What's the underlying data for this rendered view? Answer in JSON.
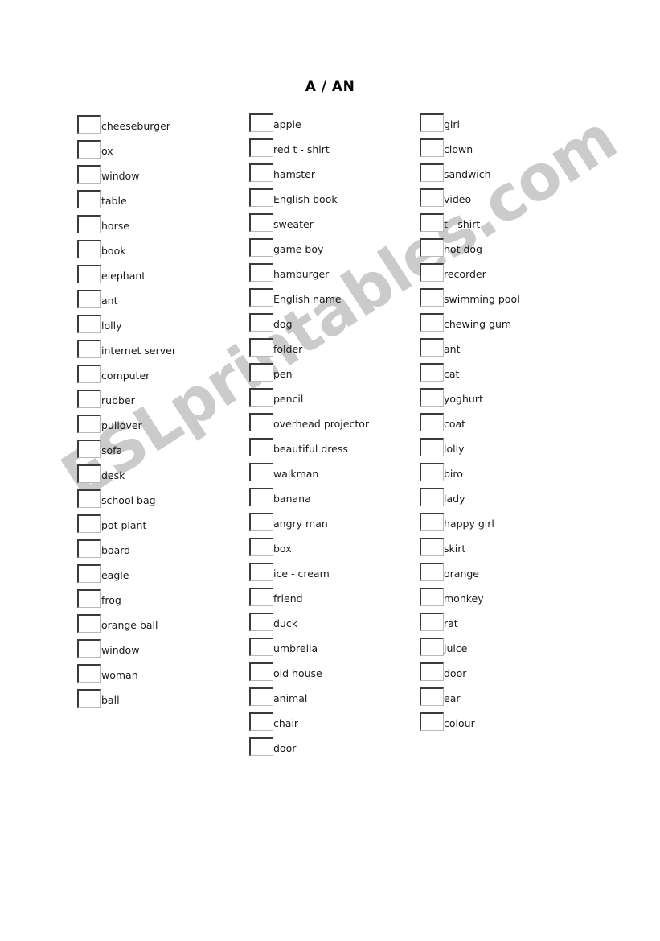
{
  "page": {
    "title": "A / AN",
    "watermark": "ESLprintables.com",
    "watermark_color": "#cbcbcb",
    "background_color": "#ffffff",
    "text_color": "#1a1a1a"
  },
  "columns": [
    {
      "id": "column-1",
      "items": [
        "cheeseburger",
        "ox",
        "window",
        "table",
        "horse",
        "book",
        "elephant",
        "ant",
        "lolly",
        "internet server",
        "computer",
        "rubber",
        "pullover",
        "sofa",
        "desk",
        "school bag",
        "pot plant",
        "board",
        "eagle",
        "frog",
        "orange ball",
        "window",
        "woman",
        "ball"
      ]
    },
    {
      "id": "column-2",
      "items": [
        "apple",
        "red t - shirt",
        "hamster",
        "English book",
        "sweater",
        "game boy",
        "hamburger",
        "English name",
        "dog",
        "folder",
        "pen",
        "pencil",
        "overhead projector",
        "beautiful dress",
        "walkman",
        "banana",
        "angry man",
        "box",
        "ice - cream",
        "friend",
        "duck",
        "umbrella",
        "old house",
        "animal",
        "chair",
        "door"
      ]
    },
    {
      "id": "column-3",
      "items": [
        "girl",
        "clown",
        "sandwich",
        "video",
        "t - shirt",
        "hot dog",
        "recorder",
        "swimming pool",
        "chewing gum",
        "ant",
        "cat",
        "yoghurt",
        "coat",
        "lolly",
        "biro",
        "lady",
        "happy girl",
        "skirt",
        "orange",
        "monkey",
        "rat",
        "juice",
        "door",
        "ear",
        "colour"
      ]
    }
  ]
}
